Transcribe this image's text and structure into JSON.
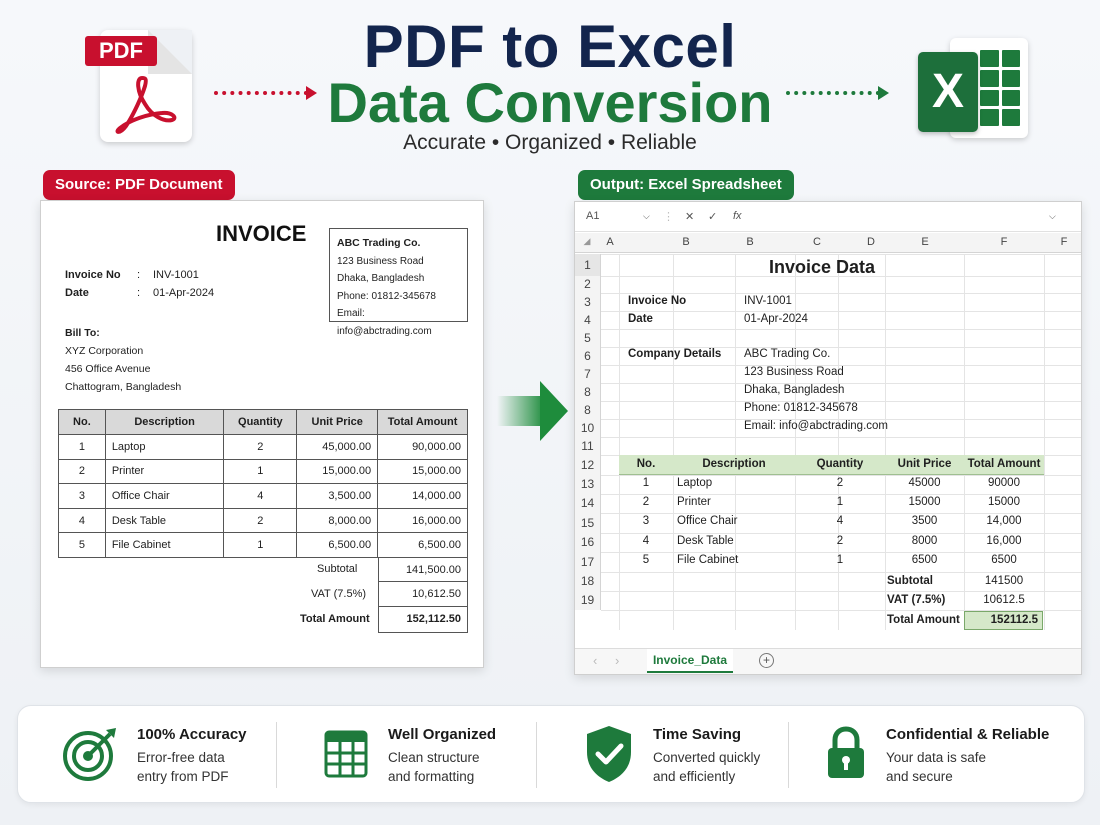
{
  "header": {
    "title_line1": "PDF to Excel",
    "title_line2": "Data Conversion",
    "subtitle": "Accurate • Organized • Reliable",
    "pdf_label": "PDF",
    "excel_letter": "X"
  },
  "source_label": "Source: PDF Document",
  "output_label": "Output: Excel Spreadsheet",
  "invoice": {
    "title": "INVOICE",
    "company": {
      "name": "ABC Trading Co.",
      "address1": "123 Business Road",
      "address2": "Dhaka, Bangladesh",
      "phone": "Phone: 01812-345678",
      "email": "Email: info@abctrading.com"
    },
    "invoice_no_label": "Invoice No",
    "invoice_no": "INV-1001",
    "date_label": "Date",
    "date": "01-Apr-2024",
    "colon": ":",
    "bill_to_label": "Bill To:",
    "bill_to": [
      "XYZ Corporation",
      "456 Office Avenue",
      "Chattogram, Bangladesh"
    ],
    "columns": [
      "No.",
      "Description",
      "Quantity",
      "Unit Price",
      "Total Amount"
    ],
    "rows": [
      [
        "1",
        "Laptop",
        "2",
        "45,000.00",
        "90,000.00"
      ],
      [
        "2",
        "Printer",
        "1",
        "15,000.00",
        "15,000.00"
      ],
      [
        "3",
        "Office Chair",
        "4",
        "3,500.00",
        "14,000.00"
      ],
      [
        "4",
        "Desk Table",
        "2",
        "8,000.00",
        "16,000.00"
      ],
      [
        "5",
        "File Cabinet",
        "1",
        "6,500.00",
        "6,500.00"
      ]
    ],
    "subtotal_label": "Subtotal",
    "subtotal": "141,500.00",
    "vat_label": "VAT (7.5%)",
    "vat": "10,612.50",
    "total_label": "Total Amount",
    "total": "152,112.50"
  },
  "excel": {
    "cell_ref": "A1",
    "col_letters": [
      "A",
      "B",
      "B",
      "C",
      "D",
      "E",
      "F",
      "F"
    ],
    "row_numbers": [
      "1",
      "2",
      "3",
      "4",
      "5",
      "6",
      "7",
      "8",
      "8",
      "10",
      "11",
      "12",
      "13",
      "14",
      "15",
      "16",
      "17",
      "18",
      "19"
    ],
    "sheet_title": "Invoice Data",
    "invoice_no_label": "Invoice No",
    "invoice_no": "INV-1001",
    "date_label": "Date",
    "date": "01-Apr-2024",
    "company_label": "Company Details",
    "company_lines": [
      "ABC Trading Co.",
      "123 Business Road",
      "Dhaka, Bangladesh",
      "Phone: 01812-345678",
      "Email: info@abctrading.com"
    ],
    "columns": [
      "No.",
      "Description",
      "Quantity",
      "Unit Price",
      "Total Amount"
    ],
    "rows": [
      [
        "1",
        "Laptop",
        "2",
        "45000",
        "90000"
      ],
      [
        "2",
        "Printer",
        "1",
        "15000",
        "15000"
      ],
      [
        "3",
        "Office Chair",
        "4",
        "3500",
        "14,000"
      ],
      [
        "4",
        "Desk Table",
        "2",
        "8000",
        "16,000"
      ],
      [
        "5",
        "File Cabinet",
        "1",
        "6500",
        "6500"
      ]
    ],
    "subtotal_label": "Subtotal",
    "subtotal": "141500",
    "vat_label": "VAT (7.5%)",
    "vat": "10612.5",
    "total_label": "Total Amount",
    "total": "152112.5",
    "sheet_tab": "Invoice_Data"
  },
  "features": [
    {
      "title": "100% Accuracy",
      "line1": "Error-free data",
      "line2": "entry from PDF",
      "icon": "target-icon"
    },
    {
      "title": "Well Organized",
      "line1": "Clean structure",
      "line2": "and formatting",
      "icon": "spreadsheet-icon"
    },
    {
      "title": "Time Saving",
      "line1": "Converted quickly",
      "line2": "and efficiently",
      "icon": "shield-check-icon"
    },
    {
      "title": "Confidential & Reliable",
      "line1": "Your data is safe",
      "line2": "and secure",
      "icon": "lock-icon"
    }
  ],
  "colors": {
    "pdf_red": "#c8102e",
    "excel_green": "#1e7a3c",
    "title_navy": "#13254d"
  }
}
